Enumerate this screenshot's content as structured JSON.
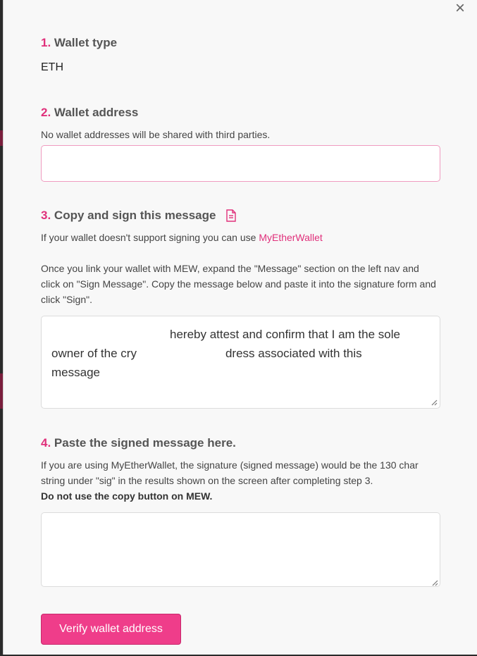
{
  "close_label": "×",
  "step1": {
    "number": "1.",
    "title": "Wallet type",
    "value": "ETH"
  },
  "step2": {
    "number": "2.",
    "title": "Wallet address",
    "description": "No wallet addresses will be shared with third parties.",
    "input_value": ""
  },
  "step3": {
    "number": "3.",
    "title": "Copy and sign this message",
    "icon": "document-icon",
    "description_prefix": "If your wallet doesn't support signing you can use ",
    "link_text": "MyEtherWallet",
    "instructions": "Once you link your wallet with MEW, expand the \"Message\" section on the left nav and click on \"Sign Message\". Copy the message below and paste it into the signature form and click \"Sign\".",
    "message_line1": "hereby attest and confirm that I am the sole",
    "message_line2a": "owner of the cry",
    "message_line2b": "dress associated with this",
    "message_line3": "message"
  },
  "step4": {
    "number": "4.",
    "title": "Paste the signed message here.",
    "description": "If you are using MyEtherWallet, the signature (signed message) would be the 130 char string under \"sig\" in the results shown on the screen after completing step 3.",
    "warning": "Do not use the copy button on MEW.",
    "textarea_value": ""
  },
  "submit_label": "Verify wallet address",
  "colors": {
    "accent": "#e0307b",
    "button": "#ef3d8a"
  }
}
